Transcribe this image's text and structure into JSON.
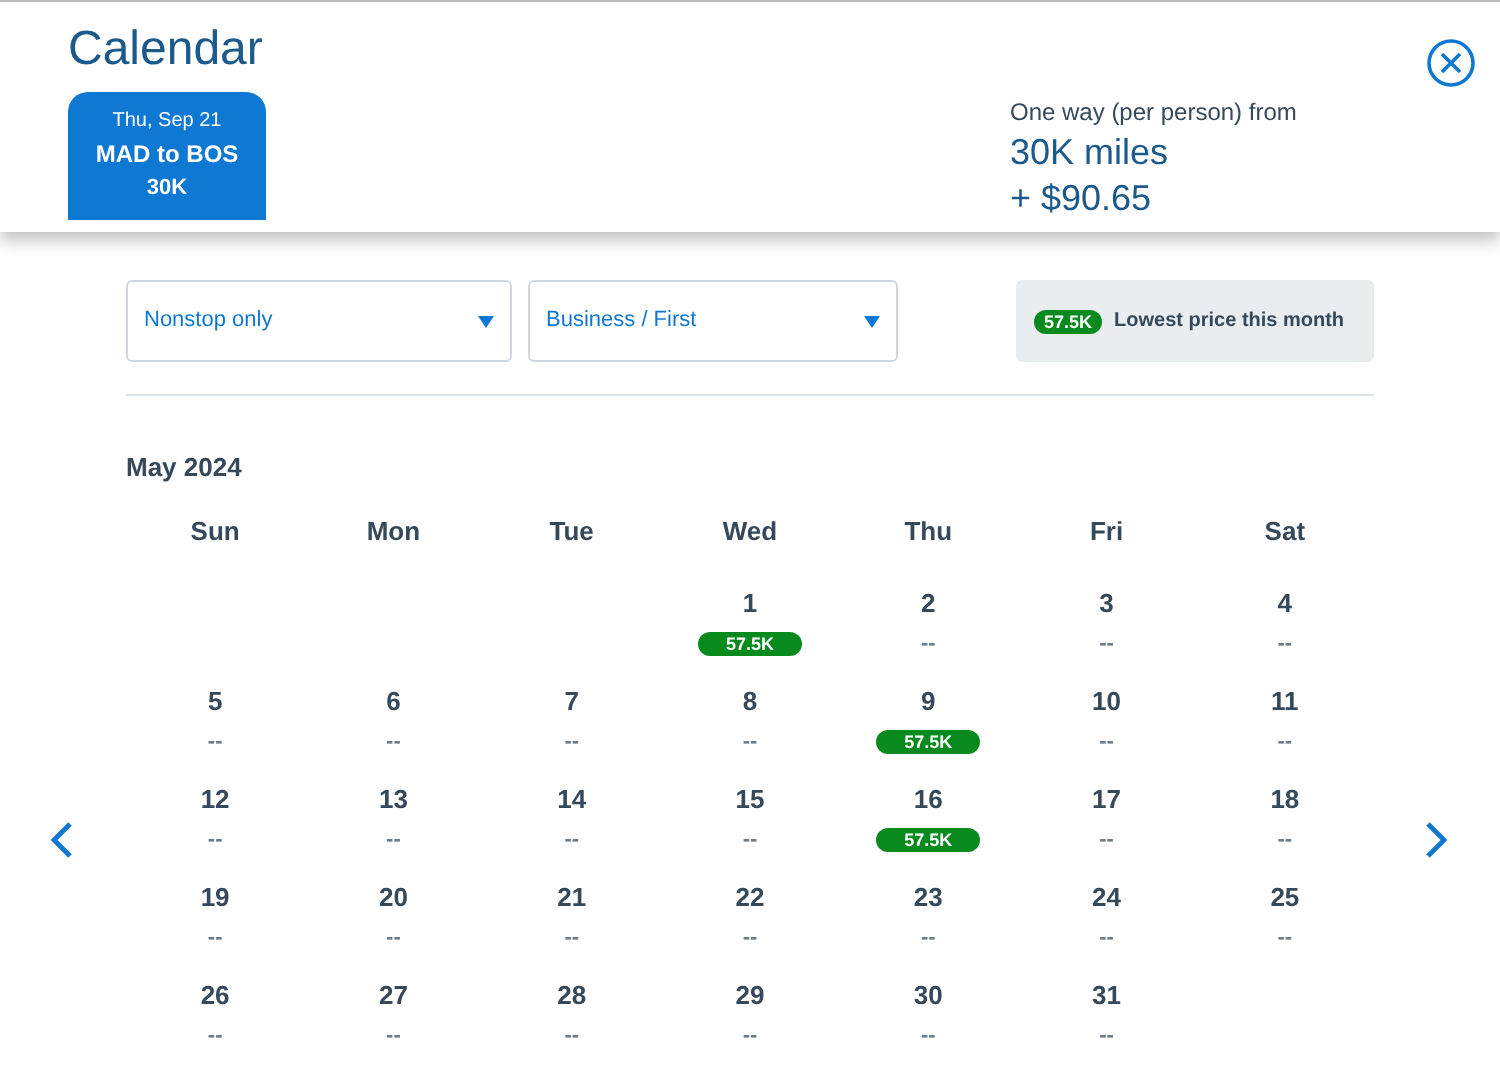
{
  "title": "Calendar",
  "trip_tab": {
    "date": "Thu, Sep 21",
    "route": "MAD to BOS",
    "price": "30K",
    "selected": true
  },
  "fare": {
    "label": "One way (per person) from",
    "miles": "30K miles",
    "taxes": "+ $90.65"
  },
  "filters": [
    {
      "value": "Nonstop only"
    },
    {
      "value": "Business / First"
    }
  ],
  "legend": {
    "badge": "57.5K",
    "label": "Lowest price this month"
  },
  "month": "May 2024",
  "weekdays": [
    "Sun",
    "Mon",
    "Tue",
    "Wed",
    "Thu",
    "Fri",
    "Sat"
  ],
  "weeks": [
    [
      {
        "day": "1",
        "price": "57.5K",
        "lowest": true
      },
      {
        "day": "2",
        "price": "--",
        "lowest": false
      },
      {
        "day": "3",
        "price": "--",
        "lowest": false
      },
      {
        "day": "4",
        "price": "--",
        "lowest": false
      }
    ],
    [
      {
        "day": "5",
        "price": "--",
        "lowest": false
      },
      {
        "day": "6",
        "price": "--",
        "lowest": false
      },
      {
        "day": "7",
        "price": "--",
        "lowest": false
      },
      {
        "day": "8",
        "price": "--",
        "lowest": false
      },
      {
        "day": "9",
        "price": "57.5K",
        "lowest": true
      },
      {
        "day": "10",
        "price": "--",
        "lowest": false
      },
      {
        "day": "11",
        "price": "--",
        "lowest": false
      }
    ],
    [
      {
        "day": "12",
        "price": "--",
        "lowest": false
      },
      {
        "day": "13",
        "price": "--",
        "lowest": false
      },
      {
        "day": "14",
        "price": "--",
        "lowest": false
      },
      {
        "day": "15",
        "price": "--",
        "lowest": false
      },
      {
        "day": "16",
        "price": "57.5K",
        "lowest": true
      },
      {
        "day": "17",
        "price": "--",
        "lowest": false
      },
      {
        "day": "18",
        "price": "--",
        "lowest": false
      }
    ],
    [
      {
        "day": "19",
        "price": "--",
        "lowest": false
      },
      {
        "day": "20",
        "price": "--",
        "lowest": false
      },
      {
        "day": "21",
        "price": "--",
        "lowest": false
      },
      {
        "day": "22",
        "price": "--",
        "lowest": false
      },
      {
        "day": "23",
        "price": "--",
        "lowest": false
      },
      {
        "day": "24",
        "price": "--",
        "lowest": false
      },
      {
        "day": "25",
        "price": "--",
        "lowest": false
      }
    ],
    [
      {
        "day": "26",
        "price": "--",
        "lowest": false
      },
      {
        "day": "27",
        "price": "--",
        "lowest": false
      },
      {
        "day": "28",
        "price": "--",
        "lowest": false
      },
      {
        "day": "29",
        "price": "--",
        "lowest": false
      },
      {
        "day": "30",
        "price": "--",
        "lowest": false
      },
      {
        "day": "31",
        "price": "--",
        "lowest": false
      }
    ]
  ]
}
